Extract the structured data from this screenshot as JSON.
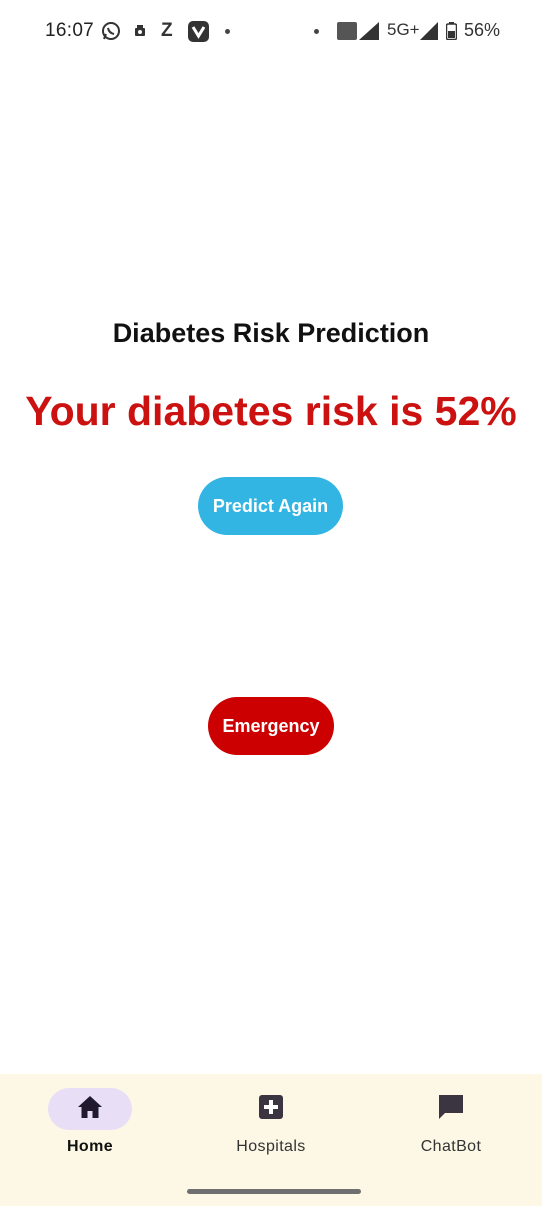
{
  "status_bar": {
    "time": "16:07",
    "network": "5G+",
    "battery": "56%",
    "icons": [
      "whatsapp-icon",
      "camera-icon",
      "z-app-icon",
      "v-app-icon",
      "vonr-icon",
      "signal-icon",
      "battery-icon"
    ]
  },
  "main": {
    "title": "Diabetes Risk Prediction",
    "result": "Your diabetes risk is 52%",
    "predict_again_label": "Predict Again",
    "emergency_label": "Emergency"
  },
  "nav": {
    "items": [
      {
        "label": "Home",
        "icon": "home-icon",
        "active": true
      },
      {
        "label": "Hospitals",
        "icon": "hospital-icon",
        "active": false
      },
      {
        "label": "ChatBot",
        "icon": "chat-icon",
        "active": false
      }
    ]
  },
  "colors": {
    "risk_text": "#cc1111",
    "predict_button": "#32b5e3",
    "emergency_button": "#cc0000",
    "nav_background": "#fdf8e6",
    "nav_active_pill": "#e8def6"
  }
}
